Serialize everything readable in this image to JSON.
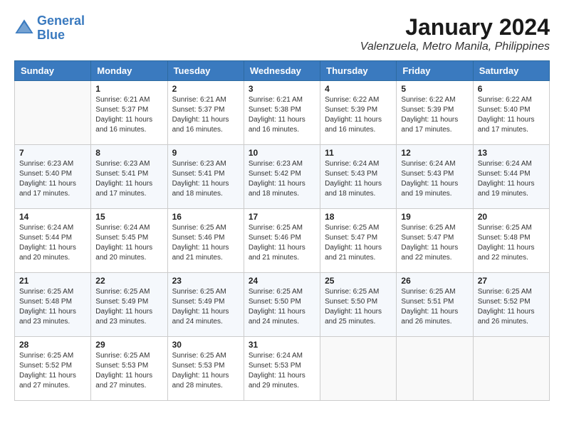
{
  "header": {
    "logo_line1": "General",
    "logo_line2": "Blue",
    "month": "January 2024",
    "location": "Valenzuela, Metro Manila, Philippines"
  },
  "weekdays": [
    "Sunday",
    "Monday",
    "Tuesday",
    "Wednesday",
    "Thursday",
    "Friday",
    "Saturday"
  ],
  "weeks": [
    [
      {
        "day": "",
        "sunrise": "",
        "sunset": "",
        "daylight": ""
      },
      {
        "day": "1",
        "sunrise": "Sunrise: 6:21 AM",
        "sunset": "Sunset: 5:37 PM",
        "daylight": "Daylight: 11 hours and 16 minutes."
      },
      {
        "day": "2",
        "sunrise": "Sunrise: 6:21 AM",
        "sunset": "Sunset: 5:37 PM",
        "daylight": "Daylight: 11 hours and 16 minutes."
      },
      {
        "day": "3",
        "sunrise": "Sunrise: 6:21 AM",
        "sunset": "Sunset: 5:38 PM",
        "daylight": "Daylight: 11 hours and 16 minutes."
      },
      {
        "day": "4",
        "sunrise": "Sunrise: 6:22 AM",
        "sunset": "Sunset: 5:39 PM",
        "daylight": "Daylight: 11 hours and 16 minutes."
      },
      {
        "day": "5",
        "sunrise": "Sunrise: 6:22 AM",
        "sunset": "Sunset: 5:39 PM",
        "daylight": "Daylight: 11 hours and 17 minutes."
      },
      {
        "day": "6",
        "sunrise": "Sunrise: 6:22 AM",
        "sunset": "Sunset: 5:40 PM",
        "daylight": "Daylight: 11 hours and 17 minutes."
      }
    ],
    [
      {
        "day": "7",
        "sunrise": "Sunrise: 6:23 AM",
        "sunset": "Sunset: 5:40 PM",
        "daylight": "Daylight: 11 hours and 17 minutes."
      },
      {
        "day": "8",
        "sunrise": "Sunrise: 6:23 AM",
        "sunset": "Sunset: 5:41 PM",
        "daylight": "Daylight: 11 hours and 17 minutes."
      },
      {
        "day": "9",
        "sunrise": "Sunrise: 6:23 AM",
        "sunset": "Sunset: 5:41 PM",
        "daylight": "Daylight: 11 hours and 18 minutes."
      },
      {
        "day": "10",
        "sunrise": "Sunrise: 6:23 AM",
        "sunset": "Sunset: 5:42 PM",
        "daylight": "Daylight: 11 hours and 18 minutes."
      },
      {
        "day": "11",
        "sunrise": "Sunrise: 6:24 AM",
        "sunset": "Sunset: 5:43 PM",
        "daylight": "Daylight: 11 hours and 18 minutes."
      },
      {
        "day": "12",
        "sunrise": "Sunrise: 6:24 AM",
        "sunset": "Sunset: 5:43 PM",
        "daylight": "Daylight: 11 hours and 19 minutes."
      },
      {
        "day": "13",
        "sunrise": "Sunrise: 6:24 AM",
        "sunset": "Sunset: 5:44 PM",
        "daylight": "Daylight: 11 hours and 19 minutes."
      }
    ],
    [
      {
        "day": "14",
        "sunrise": "Sunrise: 6:24 AM",
        "sunset": "Sunset: 5:44 PM",
        "daylight": "Daylight: 11 hours and 20 minutes."
      },
      {
        "day": "15",
        "sunrise": "Sunrise: 6:24 AM",
        "sunset": "Sunset: 5:45 PM",
        "daylight": "Daylight: 11 hours and 20 minutes."
      },
      {
        "day": "16",
        "sunrise": "Sunrise: 6:25 AM",
        "sunset": "Sunset: 5:46 PM",
        "daylight": "Daylight: 11 hours and 21 minutes."
      },
      {
        "day": "17",
        "sunrise": "Sunrise: 6:25 AM",
        "sunset": "Sunset: 5:46 PM",
        "daylight": "Daylight: 11 hours and 21 minutes."
      },
      {
        "day": "18",
        "sunrise": "Sunrise: 6:25 AM",
        "sunset": "Sunset: 5:47 PM",
        "daylight": "Daylight: 11 hours and 21 minutes."
      },
      {
        "day": "19",
        "sunrise": "Sunrise: 6:25 AM",
        "sunset": "Sunset: 5:47 PM",
        "daylight": "Daylight: 11 hours and 22 minutes."
      },
      {
        "day": "20",
        "sunrise": "Sunrise: 6:25 AM",
        "sunset": "Sunset: 5:48 PM",
        "daylight": "Daylight: 11 hours and 22 minutes."
      }
    ],
    [
      {
        "day": "21",
        "sunrise": "Sunrise: 6:25 AM",
        "sunset": "Sunset: 5:48 PM",
        "daylight": "Daylight: 11 hours and 23 minutes."
      },
      {
        "day": "22",
        "sunrise": "Sunrise: 6:25 AM",
        "sunset": "Sunset: 5:49 PM",
        "daylight": "Daylight: 11 hours and 23 minutes."
      },
      {
        "day": "23",
        "sunrise": "Sunrise: 6:25 AM",
        "sunset": "Sunset: 5:49 PM",
        "daylight": "Daylight: 11 hours and 24 minutes."
      },
      {
        "day": "24",
        "sunrise": "Sunrise: 6:25 AM",
        "sunset": "Sunset: 5:50 PM",
        "daylight": "Daylight: 11 hours and 24 minutes."
      },
      {
        "day": "25",
        "sunrise": "Sunrise: 6:25 AM",
        "sunset": "Sunset: 5:50 PM",
        "daylight": "Daylight: 11 hours and 25 minutes."
      },
      {
        "day": "26",
        "sunrise": "Sunrise: 6:25 AM",
        "sunset": "Sunset: 5:51 PM",
        "daylight": "Daylight: 11 hours and 26 minutes."
      },
      {
        "day": "27",
        "sunrise": "Sunrise: 6:25 AM",
        "sunset": "Sunset: 5:52 PM",
        "daylight": "Daylight: 11 hours and 26 minutes."
      }
    ],
    [
      {
        "day": "28",
        "sunrise": "Sunrise: 6:25 AM",
        "sunset": "Sunset: 5:52 PM",
        "daylight": "Daylight: 11 hours and 27 minutes."
      },
      {
        "day": "29",
        "sunrise": "Sunrise: 6:25 AM",
        "sunset": "Sunset: 5:53 PM",
        "daylight": "Daylight: 11 hours and 27 minutes."
      },
      {
        "day": "30",
        "sunrise": "Sunrise: 6:25 AM",
        "sunset": "Sunset: 5:53 PM",
        "daylight": "Daylight: 11 hours and 28 minutes."
      },
      {
        "day": "31",
        "sunrise": "Sunrise: 6:24 AM",
        "sunset": "Sunset: 5:53 PM",
        "daylight": "Daylight: 11 hours and 29 minutes."
      },
      {
        "day": "",
        "sunrise": "",
        "sunset": "",
        "daylight": ""
      },
      {
        "day": "",
        "sunrise": "",
        "sunset": "",
        "daylight": ""
      },
      {
        "day": "",
        "sunrise": "",
        "sunset": "",
        "daylight": ""
      }
    ]
  ]
}
